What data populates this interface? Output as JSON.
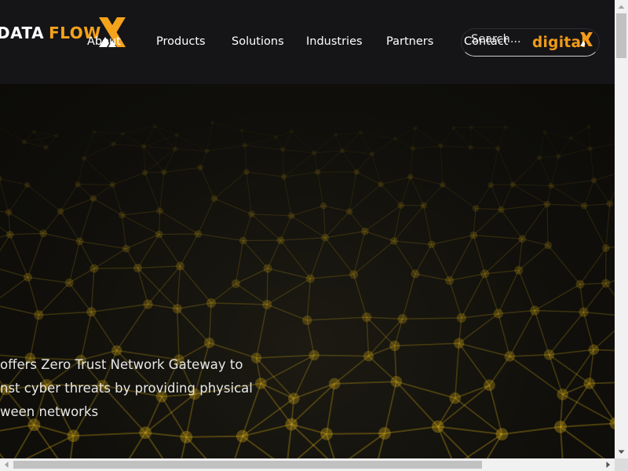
{
  "header": {
    "logo": {
      "word1": "DATA",
      "word2": "FLOW",
      "mark_icon": "x-chevron-logo-icon",
      "colors": {
        "primary": "#ffffff",
        "accent": "#f5a31a"
      }
    },
    "nav": [
      {
        "label": "About",
        "id": "about"
      },
      {
        "label": "Products",
        "id": "products"
      },
      {
        "label": "Solutions",
        "id": "solutions"
      },
      {
        "label": "Industries",
        "id": "industries"
      },
      {
        "label": "Partners",
        "id": "partners"
      },
      {
        "label": "Contact",
        "id": "contact"
      }
    ],
    "search": {
      "placeholder": "Search..."
    },
    "partner_logo": {
      "text": "digital",
      "mark_icon": "x-mark-icon",
      "color": "#f29a18"
    }
  },
  "hero": {
    "lines": [
      "offers Zero Trust Network Gateway to",
      "nst cyber threats by providing physical",
      "ween networks"
    ],
    "background_icon": "network-mesh-icon",
    "colors": {
      "node": "#f5c518",
      "background": "#100f0b"
    }
  }
}
